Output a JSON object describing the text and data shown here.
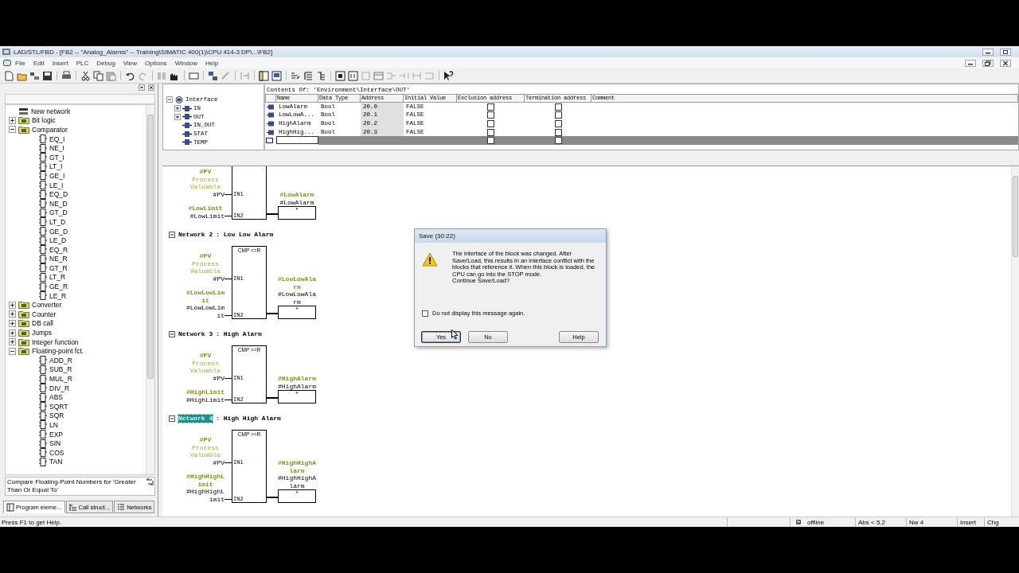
{
  "window": {
    "title": "LAD/STL/FBD  - [FB2 -- \"Analog_Alarms\" -- Training\\SIMATIC 400(1)\\CPU 414-3 DP\\...\\FB2]"
  },
  "menu": [
    "File",
    "Edit",
    "Insert",
    "PLC",
    "Debug",
    "View",
    "Options",
    "Window",
    "Help"
  ],
  "catalog": {
    "items": [
      {
        "label": "New network",
        "kind": "network"
      },
      {
        "label": "Bit logic",
        "kind": "folder",
        "expanded": false
      },
      {
        "label": "Comparator",
        "kind": "folder",
        "expanded": true,
        "children": [
          {
            "label": "EQ_I",
            "kind": "block"
          },
          {
            "label": "NE_I",
            "kind": "block"
          },
          {
            "label": "GT_I",
            "kind": "block"
          },
          {
            "label": "LT_I",
            "kind": "block"
          },
          {
            "label": "GE_I",
            "kind": "block"
          },
          {
            "label": "LE_I",
            "kind": "block"
          },
          {
            "label": "EQ_D",
            "kind": "block"
          },
          {
            "label": "NE_D",
            "kind": "block"
          },
          {
            "label": "GT_D",
            "kind": "block"
          },
          {
            "label": "LT_D",
            "kind": "block"
          },
          {
            "label": "GE_D",
            "kind": "block"
          },
          {
            "label": "LE_D",
            "kind": "block"
          },
          {
            "label": "EQ_R",
            "kind": "block"
          },
          {
            "label": "NE_R",
            "kind": "block"
          },
          {
            "label": "GT_R",
            "kind": "block"
          },
          {
            "label": "LT_R",
            "kind": "block"
          },
          {
            "label": "GE_R",
            "kind": "block"
          },
          {
            "label": "LE_R",
            "kind": "block"
          }
        ]
      },
      {
        "label": "Converter",
        "kind": "folder",
        "expanded": false
      },
      {
        "label": "Counter",
        "kind": "folder",
        "expanded": false
      },
      {
        "label": "DB call",
        "kind": "folder",
        "expanded": false
      },
      {
        "label": "Jumps",
        "kind": "folder",
        "expanded": false
      },
      {
        "label": "Integer function",
        "kind": "folder",
        "expanded": false
      },
      {
        "label": "Floating-point fct.",
        "kind": "folder",
        "expanded": true,
        "children": [
          {
            "label": "ADD_R",
            "kind": "block"
          },
          {
            "label": "SUB_R",
            "kind": "block"
          },
          {
            "label": "MUL_R",
            "kind": "block"
          },
          {
            "label": "DIV_R",
            "kind": "block"
          },
          {
            "label": "ABS",
            "kind": "block"
          },
          {
            "label": "SQRT",
            "kind": "block"
          },
          {
            "label": "SQR",
            "kind": "block"
          },
          {
            "label": "LN",
            "kind": "block"
          },
          {
            "label": "EXP",
            "kind": "block"
          },
          {
            "label": "SIN",
            "kind": "block"
          },
          {
            "label": "COS",
            "kind": "block"
          },
          {
            "label": "TAN",
            "kind": "block"
          }
        ]
      }
    ]
  },
  "description": "Compare Floating-Point Numbers for 'Greater Than Or Equal To'",
  "panel_tabs": [
    {
      "label": "Program eleme...",
      "selected": true
    },
    {
      "label": "Call struct...",
      "selected": false
    },
    {
      "label": "Networks",
      "selected": false
    }
  ],
  "interface": {
    "tree": [
      {
        "label": "Interface",
        "expanded": true,
        "children": [
          {
            "label": "IN",
            "expanded": false
          },
          {
            "label": "OUT",
            "expanded": false
          },
          {
            "label": "IN_OUT"
          },
          {
            "label": "STAT"
          },
          {
            "label": "TEMP"
          }
        ]
      }
    ],
    "contents_title": "Contents Of: 'Environment\\Interface\\OUT'",
    "columns": [
      "Name",
      "Data Type",
      "Address",
      "Initial Value",
      "Exclusion address",
      "Termination address",
      "Comment"
    ],
    "rows": [
      {
        "name": "LowAlarm",
        "data_type": "Bool",
        "address": "20.0",
        "initial_value": "FALSE",
        "exclusion": false,
        "termination": false
      },
      {
        "name": "LowLowA...",
        "data_type": "Bool",
        "address": "20.1",
        "initial_value": "FALSE",
        "exclusion": false,
        "termination": false
      },
      {
        "name": "HighAlarm",
        "data_type": "Bool",
        "address": "20.2",
        "initial_value": "FALSE",
        "exclusion": false,
        "termination": false
      },
      {
        "name": "HighHig...",
        "data_type": "Bool",
        "address": "20.3",
        "initial_value": "FALSE",
        "exclusion": false,
        "termination": false
      }
    ],
    "new_row": {
      "exclusion": false,
      "termination": false
    }
  },
  "networks": [
    {
      "in1": {
        "symbol": "#PV",
        "comment": "Process Valuable",
        "operand": "#PV",
        "pin": "IN1"
      },
      "in2": {
        "symbol": "#LowLimit",
        "operand": "#LowLimit",
        "pin": "IN2"
      },
      "out": {
        "symbol": "#LowAlarm",
        "operand": "#LowAlarm",
        "value": "*"
      }
    },
    {
      "header": {
        "label": "Network 2",
        "title": ": Low Low Alarm",
        "selected": false
      },
      "block": "CMP <=R",
      "in1": {
        "symbol": "#PV",
        "comment": "Process Valuable",
        "operand": "#PV",
        "pin": "IN1"
      },
      "in2": {
        "symbol": "#LowLowLimit",
        "operand": "#LowLowLimit",
        "pin": "IN2"
      },
      "out": {
        "symbol": "#LowLowAlarm",
        "operand": "#LowLowAlarm",
        "value": "*"
      }
    },
    {
      "header": {
        "label": "Network 3",
        "title": ": High Alarm",
        "selected": false
      },
      "block": "CMP >=R",
      "in1": {
        "symbol": "#PV",
        "comment": "Process Valuable",
        "operand": "#PV",
        "pin": "IN1"
      },
      "in2": {
        "symbol": "#HighLimit",
        "operand": "#HighLimit",
        "pin": "IN2"
      },
      "out": {
        "symbol": "#HighAlarm",
        "operand": "#HighAlarm",
        "value": "*"
      }
    },
    {
      "header": {
        "label": "Network 4",
        "title": ": High High Alarm",
        "selected": true
      },
      "block": "CMP >=R",
      "in1": {
        "symbol": "#PV",
        "comment": "Process Valuable",
        "operand": "#PV",
        "pin": "IN1"
      },
      "in2": {
        "symbol": "#HighHighLimit",
        "operand": "#HighHighLimit",
        "pin": "IN2"
      },
      "out": {
        "symbol": "#HighHighAlarm",
        "operand": "#HighHighAlarm",
        "value": "*"
      }
    }
  ],
  "dialog": {
    "title": "Save (30:22)",
    "message": "The interface of the block was changed. After Save/Load, this results in an interface conflict with the blocks that reference it. When this block is loaded, the CPU can go into the STOP mode.",
    "question": "Continue Save/Load?",
    "checkbox": {
      "label": "Do not display this message again.",
      "checked": false
    },
    "buttons": [
      {
        "label": "Yes",
        "selected": true
      },
      {
        "label": "No",
        "selected": false
      },
      {
        "label": "Help",
        "selected": false
      }
    ]
  },
  "status_bar": {
    "help": "Press F1 to get Help.",
    "fields": [
      "offline",
      "Abs < 5.2",
      "Nw 4",
      "Insert",
      "Chg"
    ]
  }
}
